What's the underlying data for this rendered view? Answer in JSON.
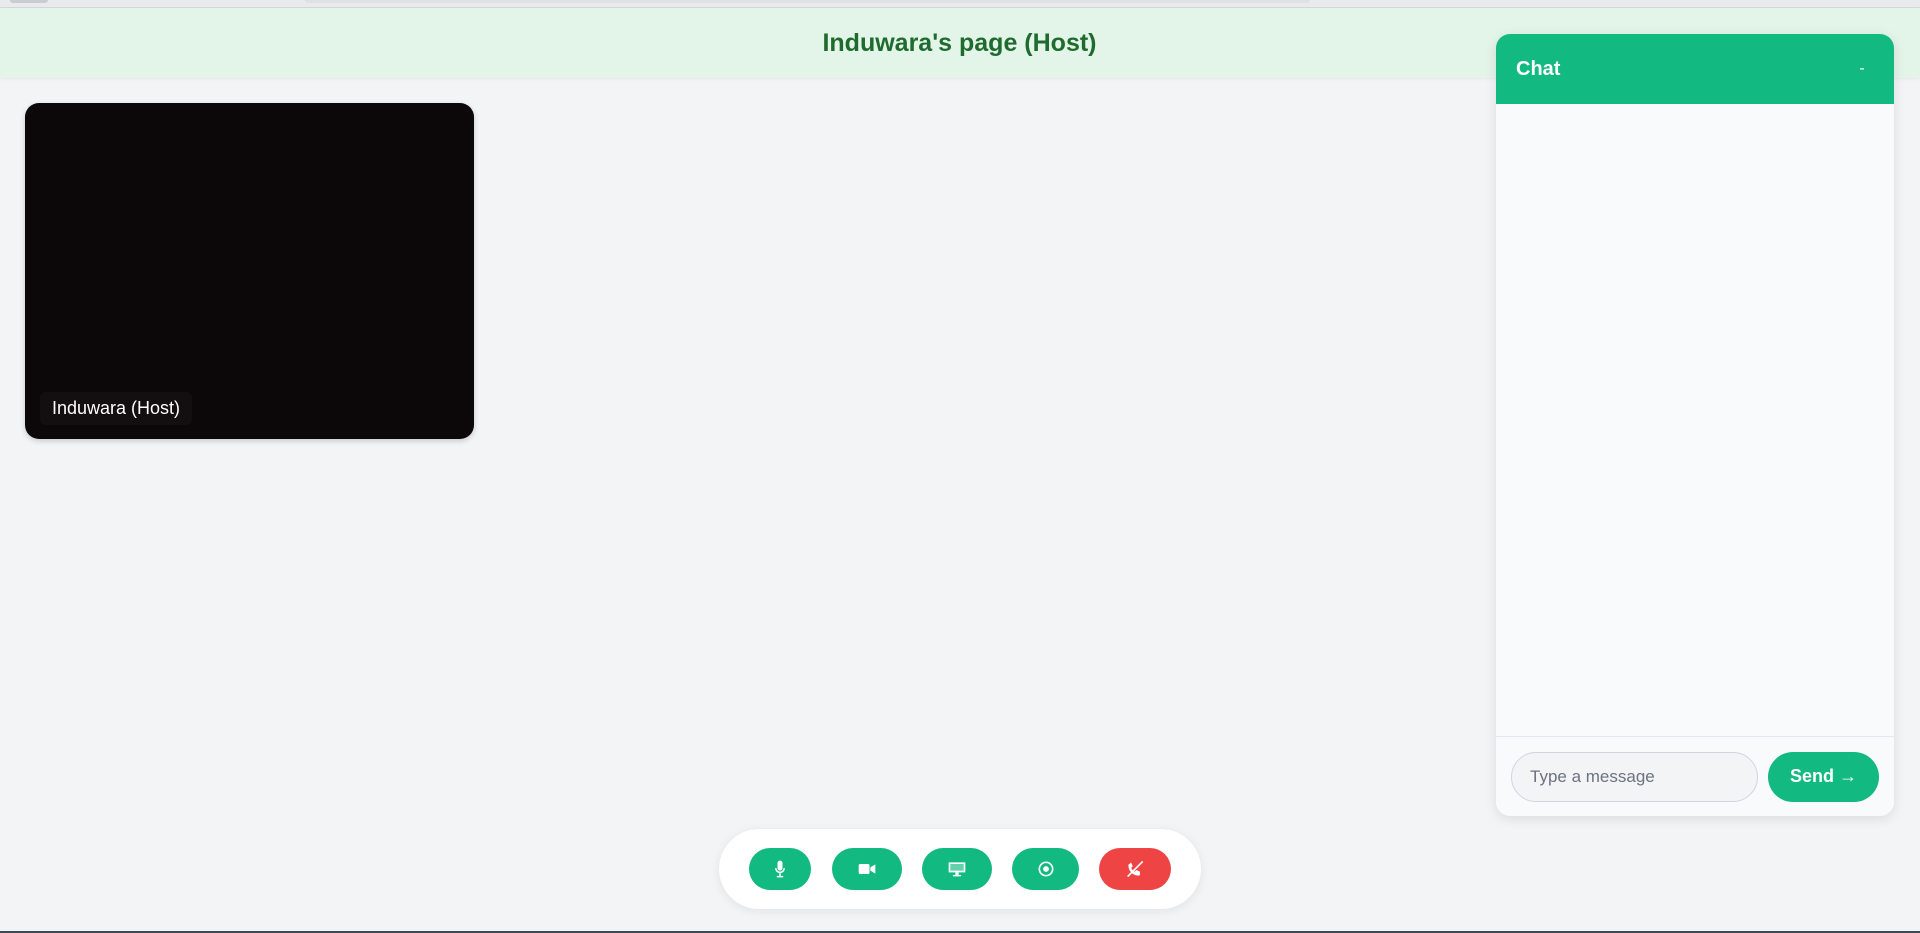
{
  "header": {
    "title": "Induwara's page (Host)"
  },
  "video": {
    "participant_label": "Induwara (Host)"
  },
  "chat": {
    "title": "Chat",
    "minimize_label": "-",
    "input_placeholder": "Type a message",
    "send_label": "Send →"
  },
  "controls": [
    {
      "name": "microphone",
      "icon": "microphone-icon"
    },
    {
      "name": "camera",
      "icon": "video-camera-icon"
    },
    {
      "name": "share-screen",
      "icon": "monitor-icon"
    },
    {
      "name": "record",
      "icon": "record-icon"
    },
    {
      "name": "end-call",
      "icon": "phone-hangup-icon"
    }
  ],
  "colors": {
    "accent": "#12b981",
    "danger": "#ef4444",
    "header_bg": "#e3f4e9",
    "title_text": "#1f6b2e"
  }
}
